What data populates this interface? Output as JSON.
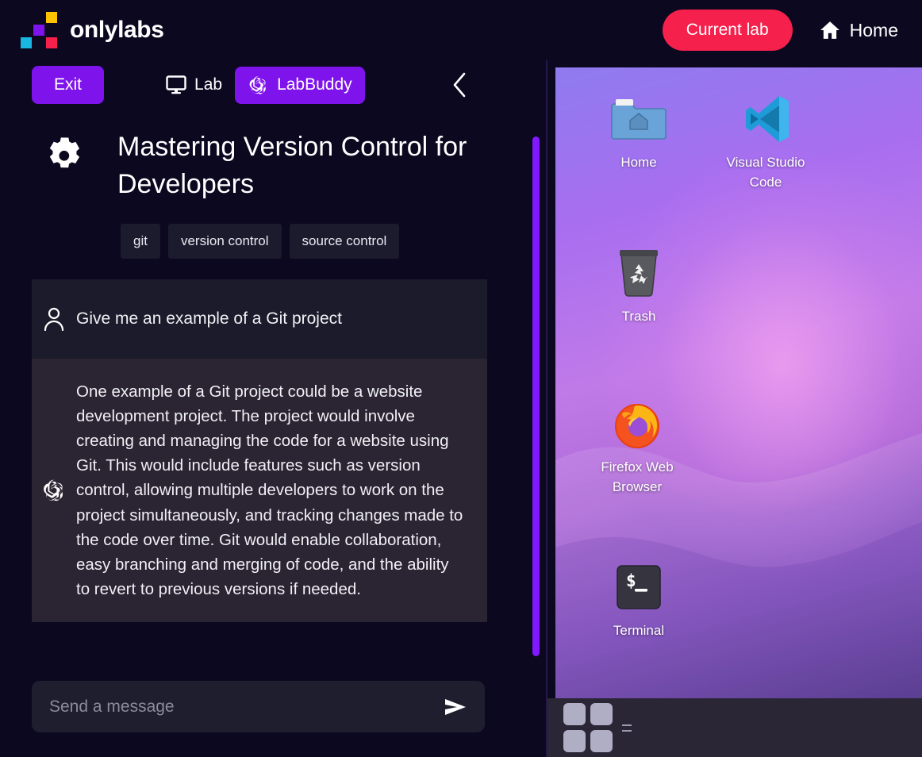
{
  "header": {
    "brand_name": "onlylabs",
    "logo_colors": [
      "#fdc300",
      "#7f13ec",
      "#18b6e0",
      "#f5204c"
    ],
    "current_lab_label": "Current lab",
    "home_label": "Home",
    "home_icon": "home-icon"
  },
  "toolbar": {
    "exit_label": "Exit",
    "lab_label": "Lab",
    "lab_icon": "monitor-icon",
    "labbuddy_label": "LabBuddy",
    "labbuddy_icon": "openai-spiral-icon",
    "collapse_icon": "chevron-left-icon",
    "active_tab": "LabBuddy"
  },
  "lab": {
    "title": "Mastering Version Control for Developers",
    "icon": "gears-icon",
    "tags": [
      "git",
      "version control",
      "source control"
    ]
  },
  "chat": {
    "messages": [
      {
        "role": "user",
        "avatar": "person-icon",
        "text": "Give me an example of a Git project"
      },
      {
        "role": "assistant",
        "avatar": "openai-spiral-icon",
        "text": "One example of a Git project could be a website development project. The project would involve creating and managing the code for a website using Git. This would include features such as version control, allowing multiple developers to work on the project simultaneously, and tracking changes made to the code over time. Git would enable collaboration, easy branching and merging of code, and the ability to revert to previous versions if needed."
      }
    ],
    "scrollbar_color": "#8118ff"
  },
  "composer": {
    "placeholder": "Send a message",
    "value": "",
    "send_icon": "send-arrow-icon"
  },
  "desktop": {
    "icons": [
      {
        "label": "Home",
        "icon": "home-folder-icon"
      },
      {
        "label": "Visual Studio Code",
        "icon": "vscode-icon"
      },
      {
        "label": "Trash",
        "icon": "trash-icon"
      },
      {
        "label": "Firefox Web Browser",
        "icon": "firefox-icon"
      },
      {
        "label": "Terminal",
        "icon": "terminal-icon"
      }
    ]
  },
  "taskbar": {
    "apps_icon": "apps-grid-icon",
    "more_icon": "dots-icon"
  }
}
